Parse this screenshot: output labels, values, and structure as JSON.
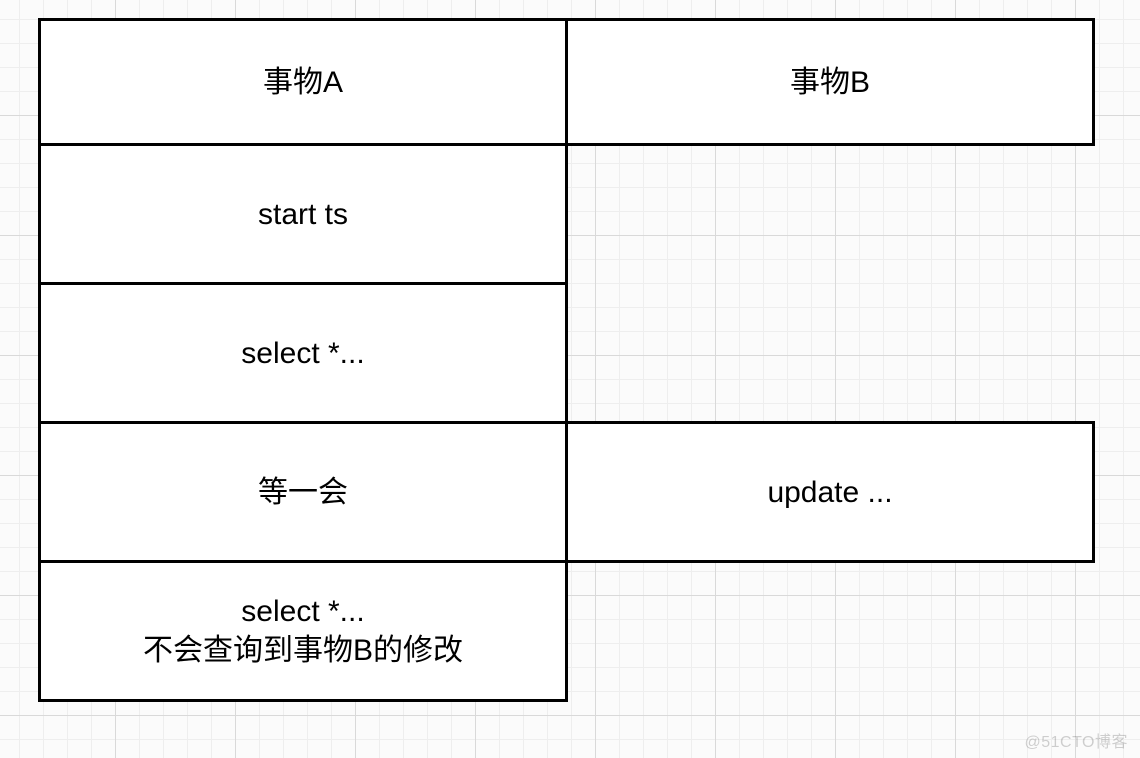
{
  "diagram": {
    "header_a": "事物A",
    "header_b": "事物B",
    "row1_a": "start ts",
    "row2_a": "select *...",
    "row3_a": "等一会",
    "row3_b": "update ...",
    "row4_a": "select *...\n不会查询到事物B的修改"
  },
  "watermark": "@51CTO博客"
}
